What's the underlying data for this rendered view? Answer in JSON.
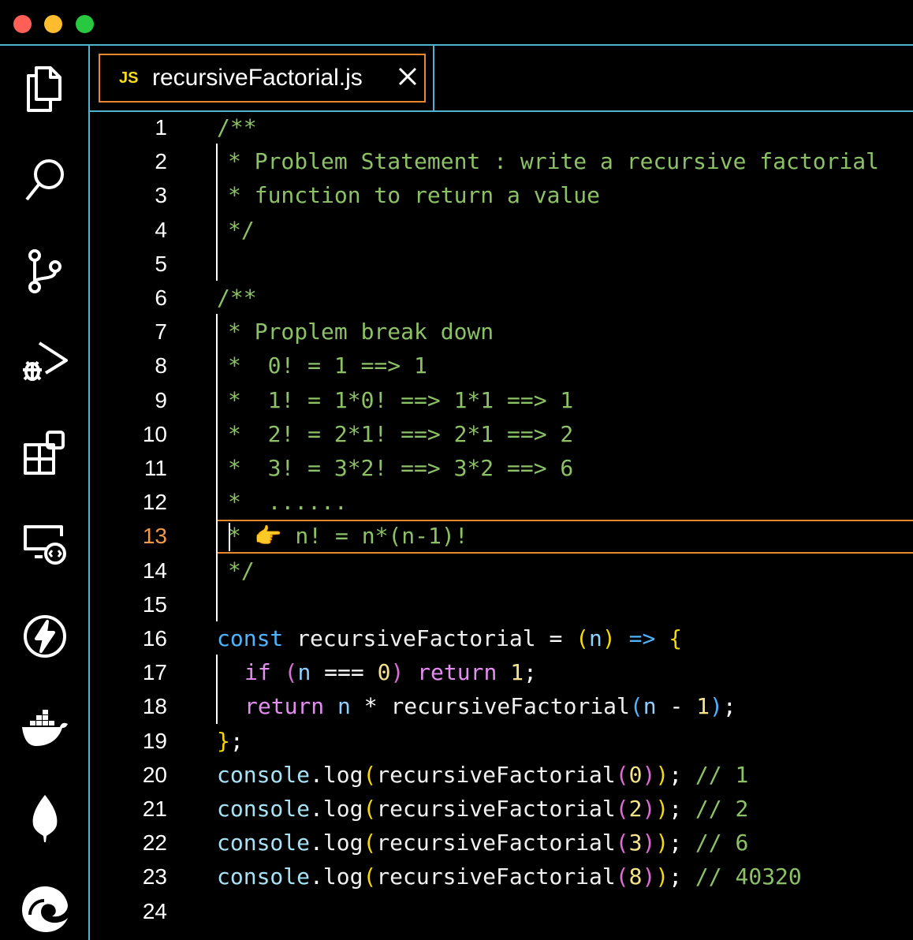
{
  "window": {
    "title": ""
  },
  "activity_bar": {
    "icons": [
      "files-icon",
      "search-icon",
      "source-control-icon",
      "run-debug-icon",
      "extensions-icon",
      "remote-explorer-icon",
      "thunder-client-icon",
      "docker-icon",
      "mongodb-leaf-icon",
      "edge-devtools-icon"
    ]
  },
  "tab": {
    "lang_badge": "JS",
    "filename": "recursiveFactorial.js",
    "close_icon": "close-icon"
  },
  "editor": {
    "active_line": 13,
    "line_numbers": [
      "1",
      "2",
      "3",
      "4",
      "5",
      "6",
      "7",
      "8",
      "9",
      "10",
      "11",
      "12",
      "13",
      "14",
      "15",
      "16",
      "17",
      "18",
      "19",
      "20",
      "21",
      "22",
      "23",
      "24"
    ],
    "lines": [
      [
        {
          "t": "/**",
          "c": "com"
        }
      ],
      [
        {
          "t": "* Problem Statement : write a recursive factorial",
          "c": "com"
        }
      ],
      [
        {
          "t": "* function to return a value",
          "c": "com"
        }
      ],
      [
        {
          "t": "*/",
          "c": "com"
        }
      ],
      [],
      [
        {
          "t": "/**",
          "c": "com"
        }
      ],
      [
        {
          "t": "* Proplem break down",
          "c": "com"
        }
      ],
      [
        {
          "t": "*  0! = 1 ==> 1",
          "c": "com"
        }
      ],
      [
        {
          "t": "*  1! = 1*0! ==> 1*1 ==> 1",
          "c": "com"
        }
      ],
      [
        {
          "t": "*  2! = 2*1! ==> 2*1 ==> 2",
          "c": "com"
        }
      ],
      [
        {
          "t": "*  3! = 3*2! ==> 3*2 ==> 6",
          "c": "com"
        }
      ],
      [
        {
          "t": "*  ......",
          "c": "com"
        }
      ],
      [
        {
          "t": "* 👉 n! = n*(n-1)!",
          "c": "com"
        }
      ],
      [
        {
          "t": "*/",
          "c": "com"
        }
      ],
      [],
      [
        {
          "t": "const",
          "c": "kw"
        },
        {
          "t": " recursiveFactorial ",
          "c": "fn"
        },
        {
          "t": "=",
          "c": "op"
        },
        {
          "t": " ",
          "c": "op"
        },
        {
          "t": "(",
          "c": "p1"
        },
        {
          "t": "n",
          "c": "var"
        },
        {
          "t": ")",
          "c": "p1"
        },
        {
          "t": " ",
          "c": "op"
        },
        {
          "t": "=>",
          "c": "kw"
        },
        {
          "t": " ",
          "c": "op"
        },
        {
          "t": "{",
          "c": "p1"
        }
      ],
      [
        {
          "t": "if",
          "c": "ctl"
        },
        {
          "t": " ",
          "c": "op"
        },
        {
          "t": "(",
          "c": "p2"
        },
        {
          "t": "n",
          "c": "var"
        },
        {
          "t": " === ",
          "c": "op"
        },
        {
          "t": "0",
          "c": "num"
        },
        {
          "t": ")",
          "c": "p2"
        },
        {
          "t": " ",
          "c": "op"
        },
        {
          "t": "return",
          "c": "ctl"
        },
        {
          "t": " ",
          "c": "op"
        },
        {
          "t": "1",
          "c": "num"
        },
        {
          "t": ";",
          "c": "op"
        }
      ],
      [
        {
          "t": "return",
          "c": "ctl"
        },
        {
          "t": " ",
          "c": "op"
        },
        {
          "t": "n",
          "c": "var"
        },
        {
          "t": " * ",
          "c": "op"
        },
        {
          "t": "recursiveFactorial",
          "c": "fn"
        },
        {
          "t": "(",
          "c": "p3"
        },
        {
          "t": "n",
          "c": "var"
        },
        {
          "t": " - ",
          "c": "op"
        },
        {
          "t": "1",
          "c": "num"
        },
        {
          "t": ")",
          "c": "p3"
        },
        {
          "t": ";",
          "c": "op"
        }
      ],
      [
        {
          "t": "}",
          "c": "p1"
        },
        {
          "t": ";",
          "c": "op"
        }
      ],
      [
        {
          "t": "console",
          "c": "obj"
        },
        {
          "t": ".",
          "c": "op"
        },
        {
          "t": "log",
          "c": "fn"
        },
        {
          "t": "(",
          "c": "p1"
        },
        {
          "t": "recursiveFactorial",
          "c": "fn"
        },
        {
          "t": "(",
          "c": "p2"
        },
        {
          "t": "0",
          "c": "num"
        },
        {
          "t": ")",
          "c": "p2"
        },
        {
          "t": ")",
          "c": "p1"
        },
        {
          "t": "; ",
          "c": "op"
        },
        {
          "t": "// 1",
          "c": "com"
        }
      ],
      [
        {
          "t": "console",
          "c": "obj"
        },
        {
          "t": ".",
          "c": "op"
        },
        {
          "t": "log",
          "c": "fn"
        },
        {
          "t": "(",
          "c": "p1"
        },
        {
          "t": "recursiveFactorial",
          "c": "fn"
        },
        {
          "t": "(",
          "c": "p2"
        },
        {
          "t": "2",
          "c": "num"
        },
        {
          "t": ")",
          "c": "p2"
        },
        {
          "t": ")",
          "c": "p1"
        },
        {
          "t": "; ",
          "c": "op"
        },
        {
          "t": "// 2",
          "c": "com"
        }
      ],
      [
        {
          "t": "console",
          "c": "obj"
        },
        {
          "t": ".",
          "c": "op"
        },
        {
          "t": "log",
          "c": "fn"
        },
        {
          "t": "(",
          "c": "p1"
        },
        {
          "t": "recursiveFactorial",
          "c": "fn"
        },
        {
          "t": "(",
          "c": "p2"
        },
        {
          "t": "3",
          "c": "num"
        },
        {
          "t": ")",
          "c": "p2"
        },
        {
          "t": ")",
          "c": "p1"
        },
        {
          "t": "; ",
          "c": "op"
        },
        {
          "t": "// 6",
          "c": "com"
        }
      ],
      [
        {
          "t": "console",
          "c": "obj"
        },
        {
          "t": ".",
          "c": "op"
        },
        {
          "t": "log",
          "c": "fn"
        },
        {
          "t": "(",
          "c": "p1"
        },
        {
          "t": "recursiveFactorial",
          "c": "fn"
        },
        {
          "t": "(",
          "c": "p2"
        },
        {
          "t": "8",
          "c": "num"
        },
        {
          "t": ")",
          "c": "p2"
        },
        {
          "t": ")",
          "c": "p1"
        },
        {
          "t": "; ",
          "c": "op"
        },
        {
          "t": "// 40320",
          "c": "com"
        }
      ],
      []
    ]
  },
  "colors": {
    "accent_border": "#4fb3cf",
    "tab_highlight": "#e8882f",
    "active_line_number": "#f2994a",
    "comment": "#8cc265",
    "keyword": "#4fb3ff",
    "control": "#e38ef0",
    "js_badge": "#f5de19"
  }
}
